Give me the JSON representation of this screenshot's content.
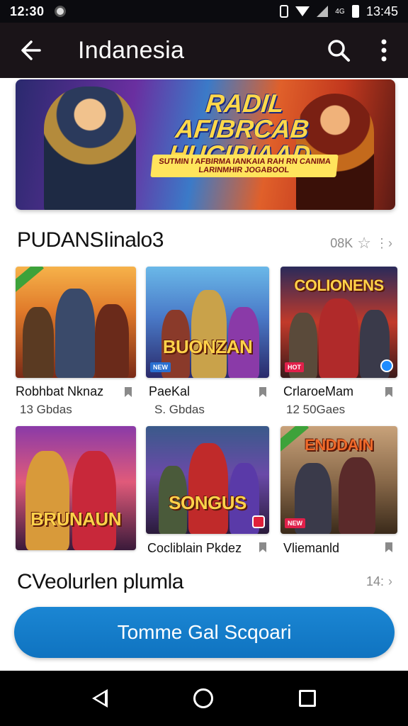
{
  "status_bar": {
    "time": "12:30",
    "net_label": "4G",
    "battery_text": "13:45"
  },
  "app_bar": {
    "title": "Indanesia"
  },
  "banner": {
    "title_line1": "RADIL AFIBRCAB",
    "title_line2": "HUCIPIAAD",
    "subtitle": "SUTMIN I AFBIRMA IANKAIA RAH RN CANIMA LARINMHIR JOGABOOL"
  },
  "section1": {
    "title": "PUDANSIinalo3",
    "meta": "08K"
  },
  "cards": [
    {
      "name": "Robhbat Nknaz",
      "size": "13 Gbdas",
      "art_title": "",
      "tag": ""
    },
    {
      "name": "PaeKal",
      "size": "S. Gbdas",
      "art_title": "BUONZAN",
      "tag": "NEW"
    },
    {
      "name": "CrlaroeMam",
      "size": "12 50Gaes",
      "art_title": "COLIONENS",
      "tag": "HOT"
    },
    {
      "name": "",
      "size": "",
      "art_title": "BRUNAUN",
      "tag": ""
    },
    {
      "name": "Cocliblain Pkdez",
      "size": "",
      "art_title": "SONGUS",
      "tag": ""
    },
    {
      "name": "Vliemanld",
      "size": "",
      "art_title": "ENDDAIN",
      "tag": "NEW"
    }
  ],
  "section2": {
    "title": "CVeolurlen plumla",
    "meta": "14:"
  },
  "cta": {
    "label": "Tomme Gal Scqoari"
  },
  "colors": {
    "accent": "#1480cc",
    "appbar": "#1a1418"
  }
}
